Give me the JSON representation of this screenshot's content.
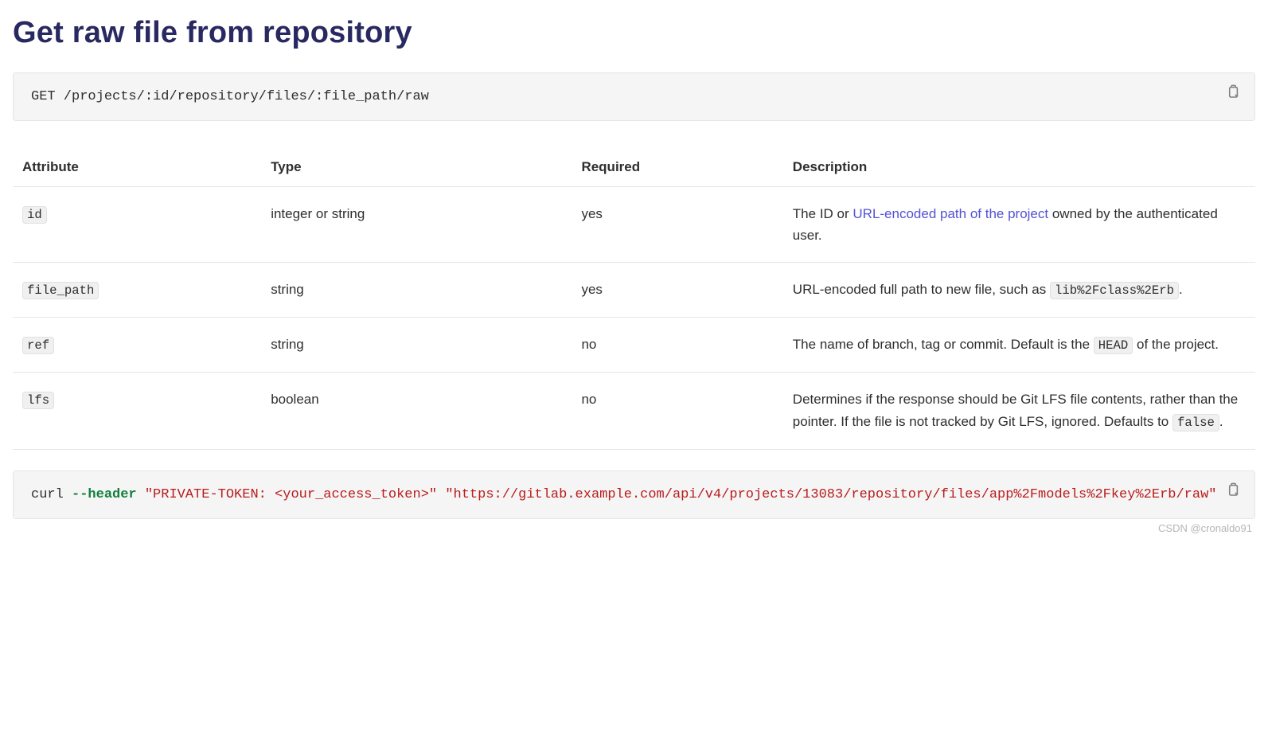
{
  "title": "Get raw file from repository",
  "endpoint_code": "GET /projects/:id/repository/files/:file_path/raw",
  "table": {
    "headers": [
      "Attribute",
      "Type",
      "Required",
      "Description"
    ],
    "rows": [
      {
        "attr": "id",
        "type": "integer or string",
        "required": "yes",
        "desc_pre": "The ID or ",
        "desc_link_text": "URL-encoded path of the project",
        "desc_post": " owned by the authenticated user.",
        "desc_code": ""
      },
      {
        "attr": "file_path",
        "type": "string",
        "required": "yes",
        "desc_pre": "URL-encoded full path to new file, such as ",
        "desc_link_text": "",
        "desc_post": ".",
        "desc_code": "lib%2Fclass%2Erb"
      },
      {
        "attr": "ref",
        "type": "string",
        "required": "no",
        "desc_pre": "The name of branch, tag or commit. Default is the ",
        "desc_link_text": "",
        "desc_post": " of the project.",
        "desc_code": "HEAD"
      },
      {
        "attr": "lfs",
        "type": "boolean",
        "required": "no",
        "desc_pre": "Determines if the response should be Git LFS file contents, rather than the pointer. If the file is not tracked by Git LFS, ignored. Defaults to ",
        "desc_link_text": "",
        "desc_post": ".",
        "desc_code": "false"
      }
    ]
  },
  "curl": {
    "cmd": "curl ",
    "opt": "--header",
    "sp1": " ",
    "str1": "\"PRIVATE-TOKEN: <your_access_token>\"",
    "sp2": " ",
    "str2": "\"https://gitlab.example.com/api/v4/projects/13083/repositor"
  },
  "watermark": "CSDN @cronaldo91"
}
